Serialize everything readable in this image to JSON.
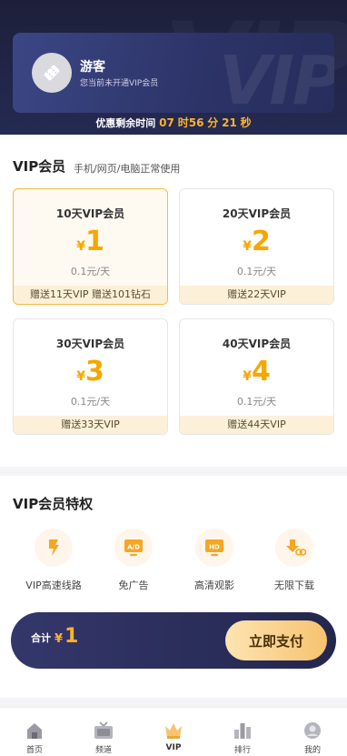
{
  "header": {
    "watermark": "VIP",
    "user": {
      "name": "游客",
      "status": "您当前未开通VIP会员"
    },
    "countdown": {
      "label": "优惠剩余时间",
      "hours": "07",
      "hours_unit": "时",
      "minutes": "56",
      "minutes_unit": "分",
      "seconds": "21",
      "seconds_unit": "秒"
    }
  },
  "packages": {
    "title": "VIP会员",
    "subtitle": "手机/网页/电脑正常使用",
    "currency": "¥",
    "items": [
      {
        "name": "10天VIP会员",
        "price": "1",
        "per_day": "0.1元/天",
        "bonus": "赠送11天VIP 赠送101钻石",
        "selected": true
      },
      {
        "name": "20天VIP会员",
        "price": "2",
        "per_day": "0.1元/天",
        "bonus": "赠送22天VIP",
        "selected": false
      },
      {
        "name": "30天VIP会员",
        "price": "3",
        "per_day": "0.1元/天",
        "bonus": "赠送33天VIP",
        "selected": false
      },
      {
        "name": "40天VIP会员",
        "price": "4",
        "per_day": "0.1元/天",
        "bonus": "赠送44天VIP",
        "selected": false
      }
    ]
  },
  "privileges": {
    "title": "VIP会员特权",
    "items": [
      {
        "label": "VIP高速线路",
        "icon": "lightning-icon"
      },
      {
        "label": "免广告",
        "icon": "no-ads-icon"
      },
      {
        "label": "高清观影",
        "icon": "hd-icon"
      },
      {
        "label": "无限下载",
        "icon": "download-icon"
      }
    ]
  },
  "paybar": {
    "total_label": "合计",
    "currency": "¥",
    "amount": "1",
    "button": "立即支付"
  },
  "tabbar": {
    "items": [
      {
        "label": "首页",
        "icon": "home-icon",
        "active": false
      },
      {
        "label": "频道",
        "icon": "tv-icon",
        "active": false
      },
      {
        "label": "VIP",
        "icon": "crown-icon",
        "active": true
      },
      {
        "label": "排行",
        "icon": "ranking-icon",
        "active": false
      },
      {
        "label": "我的",
        "icon": "profile-icon",
        "active": false
      }
    ]
  },
  "colors": {
    "accent": "#f7a600",
    "dark": "#23274e",
    "bonus_bg": "#fdf0d8"
  }
}
